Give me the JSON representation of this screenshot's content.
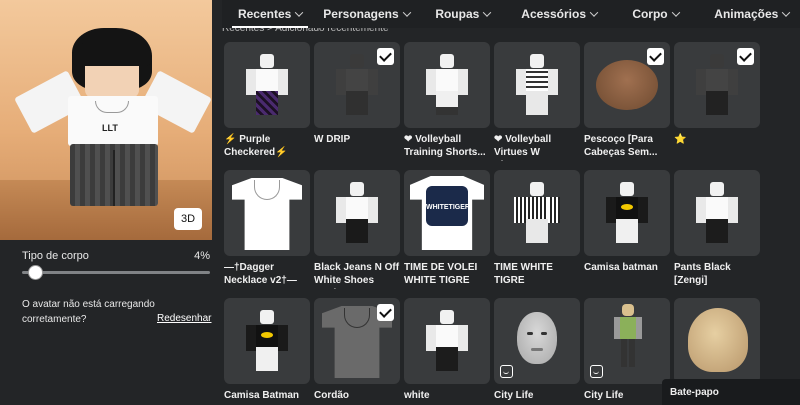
{
  "tabs": [
    {
      "label": "Recentes"
    },
    {
      "label": "Personagens"
    },
    {
      "label": "Roupas"
    },
    {
      "label": "Acessórios"
    },
    {
      "label": "Corpo"
    },
    {
      "label": "Animações"
    }
  ],
  "breadcrumb": "Recentes > Adicionado recentemente",
  "avatar": {
    "view_button": "3D",
    "shirt_text": "LLT"
  },
  "body_type": {
    "label": "Tipo de corpo",
    "value": "4%",
    "level": 0.04
  },
  "avatar_message": "O avatar não está carregando corretamente?",
  "redraw_link": "Redesenhar",
  "items": [
    {
      "name": "⚡ Purple Checkered⚡",
      "checked": false
    },
    {
      "name": "W DRIP",
      "checked": true
    },
    {
      "name": "❤ Volleyball Training Shorts...",
      "checked": false
    },
    {
      "name": "❤ Volleyball Virtues W Sleeve...",
      "checked": false
    },
    {
      "name": "Pescoço [Para Cabeças Sem...",
      "checked": true
    },
    {
      "name": "⭐",
      "checked": true
    },
    {
      "name": "—†Dagger Necklace v2†—",
      "checked": false
    },
    {
      "name": "Black Jeans N Off White Shoes Cool...",
      "checked": false
    },
    {
      "name": "TIME DE VOLEI WHITE TIGRE",
      "checked": false,
      "logo_text": "WHITETIGER"
    },
    {
      "name": "TIME WHITE TIGRE",
      "checked": false
    },
    {
      "name": "Camisa batman",
      "checked": false
    },
    {
      "name": "Pants Black [Zengi]",
      "checked": false
    },
    {
      "name": "Camisa Batman",
      "checked": false
    },
    {
      "name": "Cordão",
      "checked": true
    },
    {
      "name": "white",
      "checked": false
    },
    {
      "name": "City Life",
      "checked": false,
      "animation": true
    },
    {
      "name": "City Life",
      "checked": false,
      "animation": true
    },
    {
      "name": "",
      "checked": false
    }
  ],
  "chat_label": "Bate-papo",
  "icons": {
    "checkmark": "checkmark-icon",
    "chevron": "chevron-down-icon",
    "animation": "animation-badge-icon"
  }
}
